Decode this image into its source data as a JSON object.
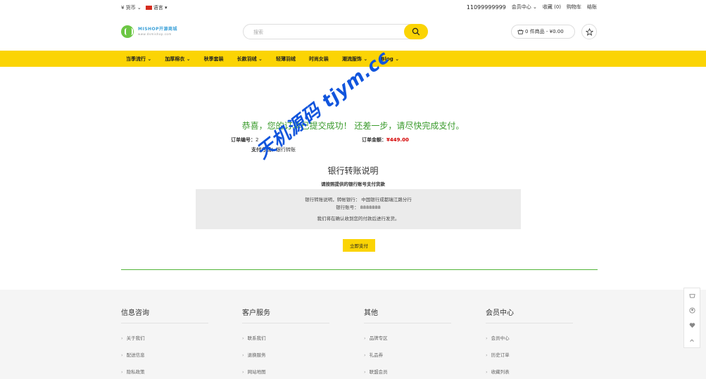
{
  "topbar": {
    "currency": "¥ 货币",
    "language": "语言",
    "phone": "11099999999",
    "member_center": "会员中心",
    "favorites": "收藏 (0)",
    "cart": "购物车",
    "checkout": "结账"
  },
  "header": {
    "logo_main": "MISHOP开源商城",
    "logo_sub": "www.dsmishop.com",
    "search_placeholder": "搜索",
    "cart_summary": "0 件商品 - ¥0.00"
  },
  "nav": {
    "items": [
      {
        "label": "当季流行",
        "has_dropdown": true
      },
      {
        "label": "加厚棉衣",
        "has_dropdown": true
      },
      {
        "label": "秋季套装",
        "has_dropdown": false
      },
      {
        "label": "长款羽绒",
        "has_dropdown": true
      },
      {
        "label": "轻薄羽绒",
        "has_dropdown": false
      },
      {
        "label": "时尚女装",
        "has_dropdown": false
      },
      {
        "label": "潮流服饰",
        "has_dropdown": true
      },
      {
        "label": "Blog",
        "has_dropdown": true
      }
    ]
  },
  "order": {
    "success_message": "恭喜，您的订单已提交成功！ 还差一步，请尽快完成支付。",
    "number_label": "订单编号：",
    "number_value": "2",
    "amount_label": "订单金额：",
    "amount_value": "¥449.00",
    "payment_label": "支付方式：",
    "payment_value": "银行转账"
  },
  "bank": {
    "title": "银行转账说明",
    "subtitle": "请按照提供的银行账号支付货款",
    "line1": "银行转账说明，转帐银行：  中国银行成都瑞江路分行",
    "line2": "银行账号：  8888888",
    "line3": "我们将在确认收到您的付款后进行发货。",
    "pay_button": "立即支付"
  },
  "footer": {
    "columns": [
      {
        "title": "信息咨询",
        "items": [
          "关于我们",
          "配送信息",
          "隐私政策"
        ]
      },
      {
        "title": "客户服务",
        "items": [
          "联系我们",
          "退换服务",
          "网站地图"
        ]
      },
      {
        "title": "其他",
        "items": [
          "品牌专区",
          "礼品券",
          "联盟会员"
        ]
      },
      {
        "title": "会员中心",
        "items": [
          "会员中心",
          "历史订单",
          "收藏列表"
        ]
      }
    ]
  },
  "watermark": "天机源码 tjym.cc",
  "colors": {
    "accent": "#fbd404",
    "success": "#3a9b2c",
    "price": "#d40000",
    "footer_bg": "#f5f5f5"
  }
}
